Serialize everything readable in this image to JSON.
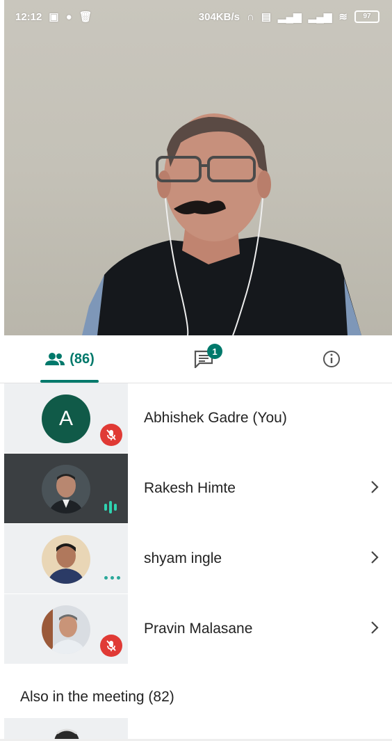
{
  "status_bar": {
    "time": "12:12",
    "net_speed": "304KB/s",
    "battery": "97"
  },
  "video": {
    "speaker_icon": "person-video-feed"
  },
  "tabs": {
    "people_count": "(86)",
    "chat_badge": "1",
    "active_tab": "people",
    "accent_color": "#00796b"
  },
  "participants": [
    {
      "name": "Abhishek Gadre (You)",
      "avatar_letter": "A",
      "status": "muted",
      "avatar_color": "#105a48"
    },
    {
      "name": "Rakesh Himte",
      "status": "speaking",
      "chevron": "chevron-right-icon"
    },
    {
      "name": "shyam ingle",
      "status": "connecting",
      "chevron": "chevron-right-icon"
    },
    {
      "name": "Pravin Malasane",
      "status": "muted",
      "chevron": "chevron-right-icon"
    }
  ],
  "also_in_meeting": "Also in the meeting (82)"
}
